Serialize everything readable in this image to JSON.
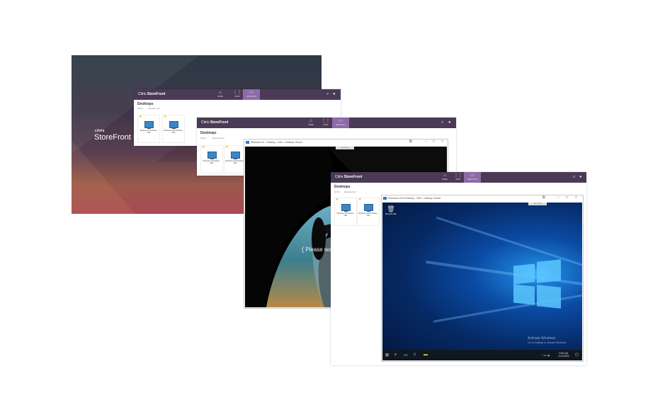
{
  "splash": {
    "brand_small": "citrix",
    "brand_title": "StoreFront"
  },
  "storefront": {
    "brand_light": "Citrix",
    "brand_bold": "StoreFront",
    "tabs": [
      {
        "icon": "⌂",
        "label": "HOME"
      },
      {
        "icon": "⋮⋮",
        "label": "APPS"
      },
      {
        "icon": "▭",
        "label": "DESKTOPS"
      }
    ],
    "section_title": "Desktops",
    "filter_all": "All (2)",
    "filter_fav": "Favorites (2)",
    "tiles": [
      {
        "name": "Windows 10 Desktop - VM1"
      },
      {
        "name": "Windows 2016 Desktop - VM2"
      }
    ]
  },
  "viewer1": {
    "title": "Windows 10 - Desktop - VM1 - Desktop Viewer",
    "wait_text": "Please wait"
  },
  "viewer2": {
    "title": "Windows 2016 Desktop - VM2 - Desktop Viewer",
    "recycle_label": "Recycle Bin",
    "activate_title": "Activate Windows",
    "activate_sub": "Go to Settings to activate Windows.",
    "clock_time": "9:55 AM",
    "clock_date": "1/14/2020"
  },
  "colors": {
    "bar": "#4b3a55",
    "active_tab": "#8f6aa8",
    "win_blue": "#1c7fd6"
  }
}
